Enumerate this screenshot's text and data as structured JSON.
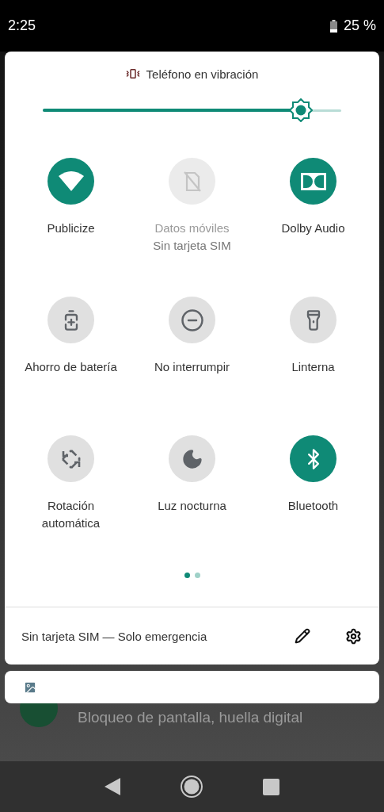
{
  "status_bar": {
    "time": "2:25",
    "battery": "25 %"
  },
  "ringer": {
    "label": "Teléfono en vibración"
  },
  "brightness": {
    "level": 0.865
  },
  "tiles": [
    {
      "kind": "wifi",
      "label": "Publicize",
      "on": true,
      "disabled": false
    },
    {
      "kind": "no-sim",
      "label": "Datos móviles",
      "sublabel": "Sin tarjeta SIM",
      "on": false,
      "disabled": true
    },
    {
      "kind": "dolby",
      "label": "Dolby Audio",
      "on": true,
      "disabled": false
    },
    {
      "kind": "battery-saver",
      "label": "Ahorro de batería",
      "on": false,
      "disabled": false
    },
    {
      "kind": "dnd",
      "label": "No interrumpir",
      "on": false,
      "disabled": false
    },
    {
      "kind": "flashlight",
      "label": "Linterna",
      "on": false,
      "disabled": false
    },
    {
      "kind": "rotation",
      "label": "Rotación automática",
      "on": false,
      "disabled": false
    },
    {
      "kind": "night",
      "label": "Luz nocturna",
      "on": false,
      "disabled": false
    },
    {
      "kind": "bluetooth",
      "label": "Bluetooth",
      "on": true,
      "disabled": false
    }
  ],
  "pager": [
    {
      "selected": true
    },
    {
      "selected": false
    }
  ],
  "footer": {
    "text": "Sin tarjeta SIM — Solo emergencia"
  },
  "background": {
    "text": "Bloqueo de pantalla, huella digital"
  }
}
